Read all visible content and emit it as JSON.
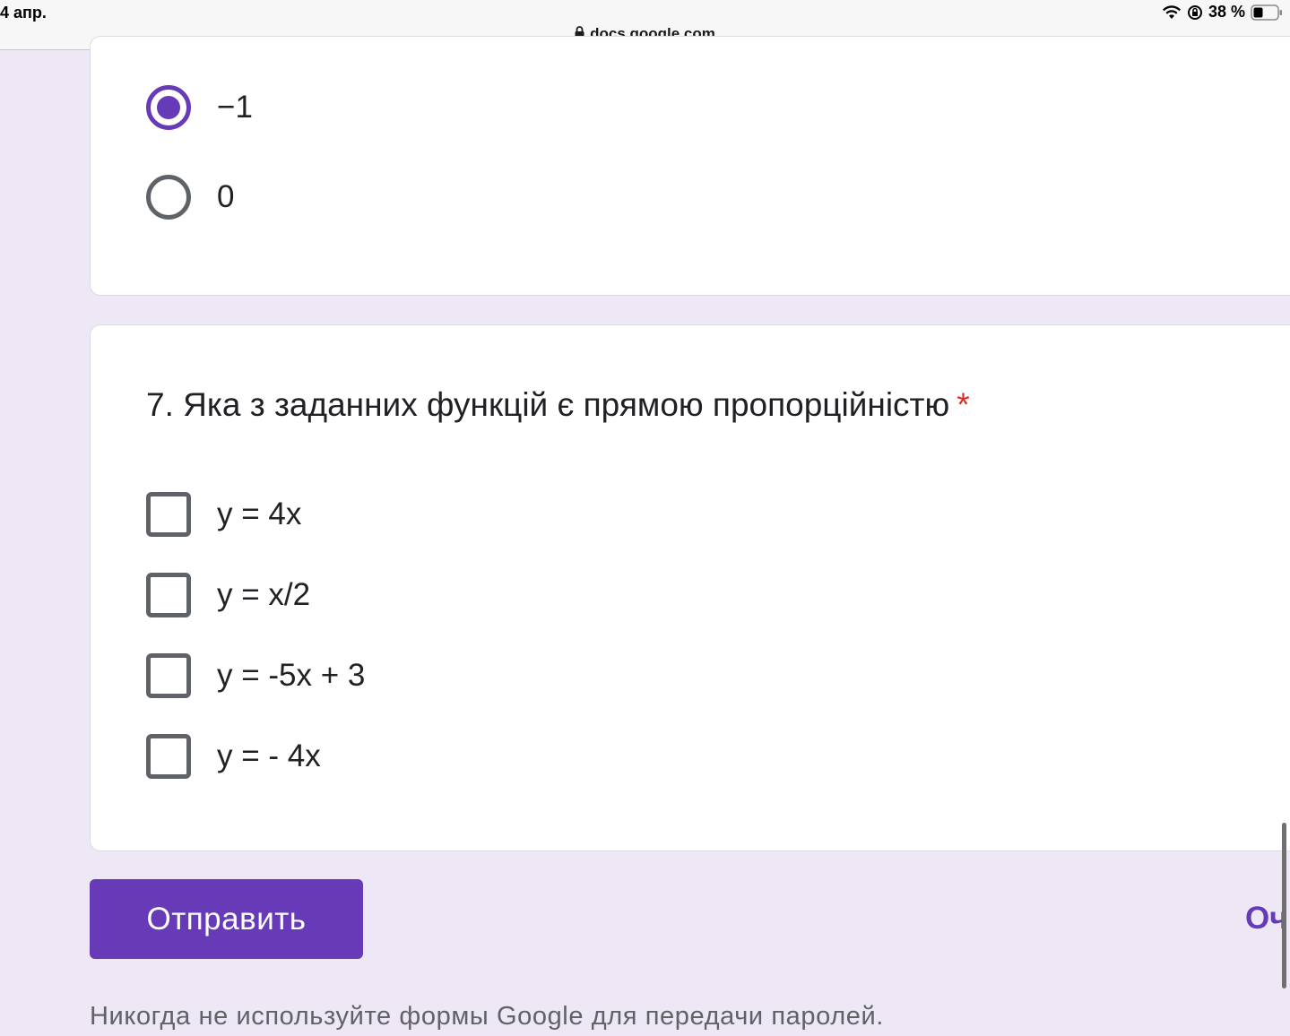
{
  "status_bar": {
    "time": "4 апр.",
    "battery": "38 %",
    "url": "docs.google.com",
    "icons": [
      "wifi-icon",
      "rotation-lock-icon",
      "battery-icon",
      "lock-icon"
    ]
  },
  "previous_question": {
    "options": [
      {
        "label": "−1",
        "selected": true
      },
      {
        "label": "0",
        "selected": false
      }
    ]
  },
  "question7": {
    "title": "7. Яка з заданних функцій є прямою пропорційністю",
    "required_mark": "*",
    "options": [
      {
        "label": "y = 4x",
        "checked": false
      },
      {
        "label": "y = x/2",
        "checked": false
      },
      {
        "label": "y = -5x + 3",
        "checked": false
      },
      {
        "label": "y = - 4x",
        "checked": false
      }
    ]
  },
  "actions": {
    "submit_label": "Отправить",
    "clear_label": "Оч"
  },
  "footer": {
    "note": "Никогда не используйте формы Google для передачи паролей."
  },
  "colors": {
    "accent": "#673ab7",
    "background": "#ede7f6",
    "required": "#d93025"
  }
}
